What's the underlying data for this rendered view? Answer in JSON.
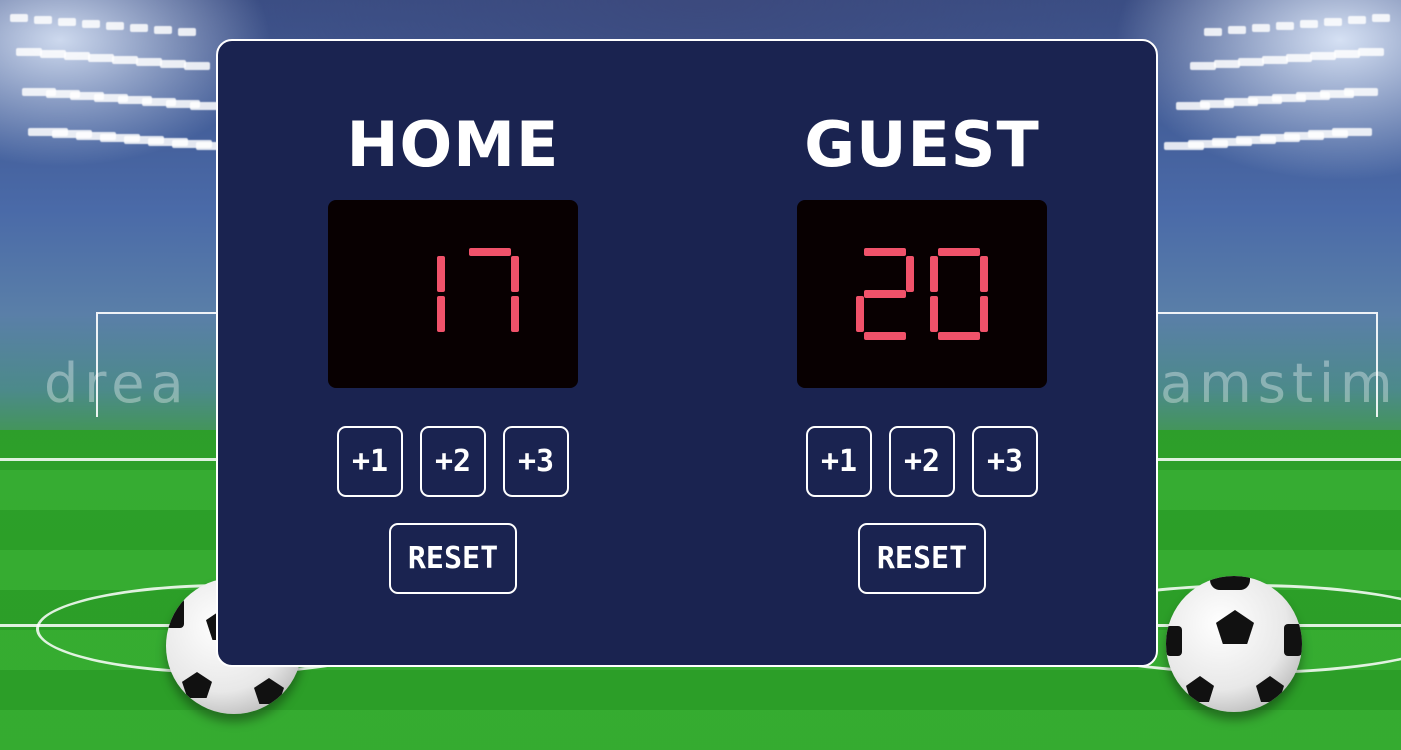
{
  "scoreboard": {
    "home": {
      "title": "HOME",
      "score": "17",
      "buttons": [
        "+1",
        "+2",
        "+3"
      ],
      "reset_label": "RESET"
    },
    "guest": {
      "title": "GUEST",
      "score": "20",
      "buttons": [
        "+1",
        "+2",
        "+3"
      ],
      "reset_label": "RESET"
    }
  },
  "background": {
    "watermark_left": "drea",
    "watermark_right": "amstime"
  },
  "colors": {
    "board": "#1a2350",
    "score_display": "#080001",
    "score_digits": "#f0526a",
    "text": "#ffffff"
  },
  "icons": {
    "left_ball": "soccer-ball-icon",
    "right_ball": "soccer-ball-icon"
  }
}
